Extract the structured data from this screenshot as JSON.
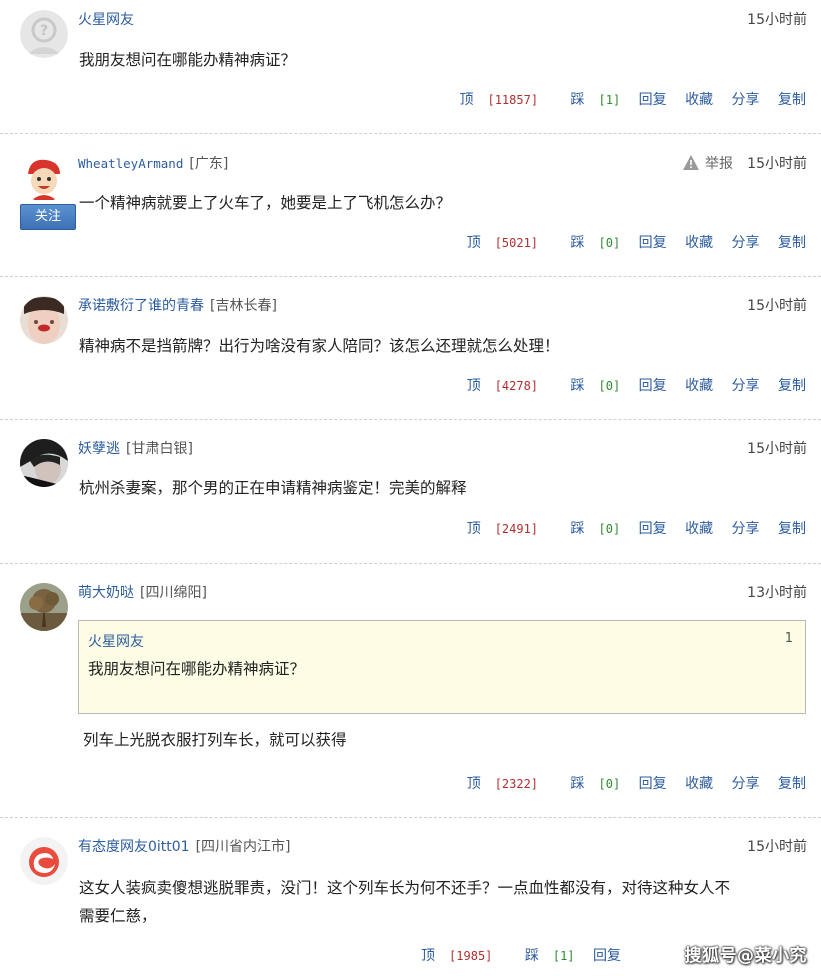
{
  "comments": [
    {
      "user": "火星网友",
      "location": "",
      "time": "15小时前",
      "text": "我朋友想问在哪能办精神病证？",
      "up": "顶",
      "up_count": "[11857]",
      "down": "踩",
      "down_count": "[1]",
      "reply": "回复",
      "fav": "收藏",
      "share": "分享",
      "copy": "复制"
    },
    {
      "user": "WheatleyArmand",
      "location": "[广东]",
      "time": "15小时前",
      "report": "举报",
      "follow": "关注",
      "text": "一个精神病就要上了火车了，她要是上了飞机怎么办？",
      "up": "顶",
      "up_count": "[5021]",
      "down": "踩",
      "down_count": "[0]",
      "reply": "回复",
      "fav": "收藏",
      "share": "分享",
      "copy": "复制"
    },
    {
      "user": "承诺敷衍了谁的青春",
      "location": "[吉林长春]",
      "time": "15小时前",
      "text": "精神病不是挡箭牌？出行为啥没有家人陪同？该怎么还理就怎么处理！",
      "up": "顶",
      "up_count": "[4278]",
      "down": "踩",
      "down_count": "[0]",
      "reply": "回复",
      "fav": "收藏",
      "share": "分享",
      "copy": "复制"
    },
    {
      "user": "妖孽逃",
      "location": "[甘肃白银]",
      "time": "15小时前",
      "text": "杭州杀妻案，那个男的正在申请精神病鉴定！完美的解释",
      "up": "顶",
      "up_count": "[2491]",
      "down": "踩",
      "down_count": "[0]",
      "reply": "回复",
      "fav": "收藏",
      "share": "分享",
      "copy": "复制"
    },
    {
      "user": "萌大奶哒",
      "location": "[四川绵阳]",
      "time": "13小时前",
      "quote": {
        "user": "火星网友",
        "num": "1",
        "text": "我朋友想问在哪能办精神病证？"
      },
      "text": "列车上光脱衣服打列车长，就可以获得",
      "up": "顶",
      "up_count": "[2322]",
      "down": "踩",
      "down_count": "[0]",
      "reply": "回复",
      "fav": "收藏",
      "share": "分享",
      "copy": "复制"
    },
    {
      "user": "有态度网友0itt01",
      "location": "[四川省内江市]",
      "time": "15小时前",
      "text_line1": "这女人装疯卖傻想逃脱罪责，没门！这个列车长为何不还手？一点血性都没有，对待这种女人不",
      "text_line2": "需要仁慈，",
      "up": "顶",
      "up_count": "[1985]",
      "down": "踩",
      "down_count": "[1]",
      "reply": "回复"
    }
  ],
  "watermark": "搜狐号@菜小究",
  "colors": {
    "link": "#2d5d9e",
    "up_count": "#b03030",
    "down_count": "#2f8a2f",
    "follow_button": "#3d72b6",
    "quote_bg": "#fdfde6"
  },
  "icons": [
    "default-avatar-icon",
    "warning-icon",
    "netease-logo-icon"
  ]
}
